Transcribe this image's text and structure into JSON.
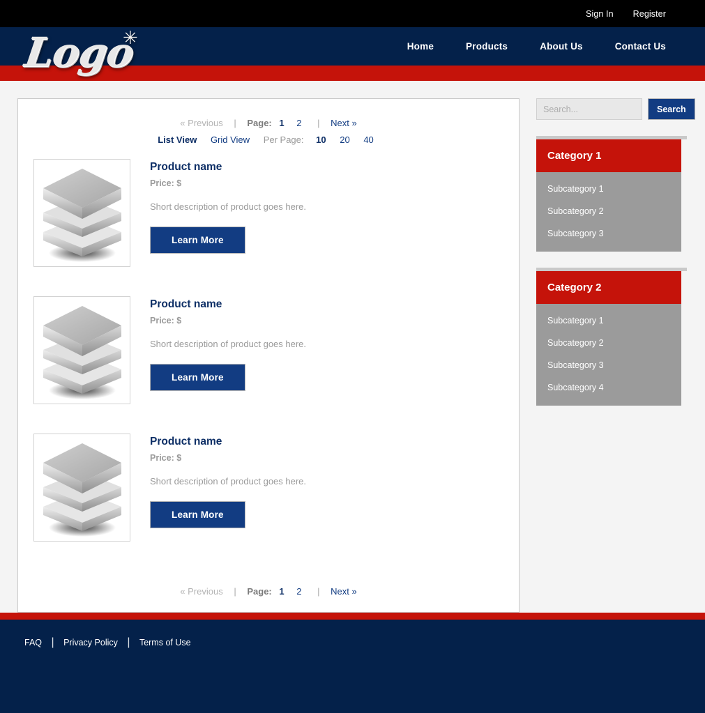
{
  "colors": {
    "navy": "#04214a",
    "red": "#c5130a",
    "button_blue": "#123c82",
    "gray_sub": "#9b9b9b",
    "page_bg": "#f4f4f4"
  },
  "topbar": {
    "links": [
      {
        "label": "Sign In",
        "name": "sign-in-link"
      },
      {
        "label": "Register",
        "name": "register-link"
      }
    ]
  },
  "header": {
    "logo_text": "Logo",
    "logo_star": "✳",
    "nav": [
      {
        "label": "Home"
      },
      {
        "label": "Products"
      },
      {
        "label": "About Us"
      },
      {
        "label": "Contact Us"
      }
    ]
  },
  "pager_top": {
    "previous": "« Previous",
    "page_label": "Page:",
    "pages": [
      "1",
      "2"
    ],
    "next": "Next »",
    "separator": "|"
  },
  "viewbar": {
    "list_view": "List View",
    "grid_view": "Grid View",
    "per_page_label": "Per Page:",
    "per_page_options": [
      "10",
      "20",
      "40"
    ],
    "active_view": "List View",
    "active_per_page": "10"
  },
  "products": [
    {
      "name": "Product name",
      "price": "Price: $",
      "description": "Short description of product goes here.",
      "button": "Learn More",
      "image": "stacked-layers-placeholder"
    },
    {
      "name": "Product name",
      "price": "Price: $",
      "description": "Short description of product goes here.",
      "button": "Learn More",
      "image": "stacked-layers-placeholder"
    },
    {
      "name": "Product name",
      "price": "Price: $",
      "description": "Short description of product goes here.",
      "button": "Learn More",
      "image": "stacked-layers-placeholder"
    }
  ],
  "pager_bottom": {
    "previous": "« Previous",
    "page_label": "Page:",
    "pages": [
      "1",
      "2"
    ],
    "next": "Next »",
    "separator": "|"
  },
  "sidebar": {
    "search": {
      "placeholder": "Search...",
      "value": "",
      "button_label": "Search"
    },
    "categories": [
      {
        "title": "Category 1",
        "subcategories": [
          "Subcategory 1",
          "Subcategory 2",
          "Subcategory 3"
        ]
      },
      {
        "title": "Category 2",
        "subcategories": [
          "Subcategory 1",
          "Subcategory 2",
          "Subcategory 3",
          "Subcategory 4"
        ]
      }
    ]
  },
  "footer": {
    "links": [
      "FAQ",
      "Privacy Policy",
      "Terms of Use"
    ],
    "separator": "|"
  }
}
